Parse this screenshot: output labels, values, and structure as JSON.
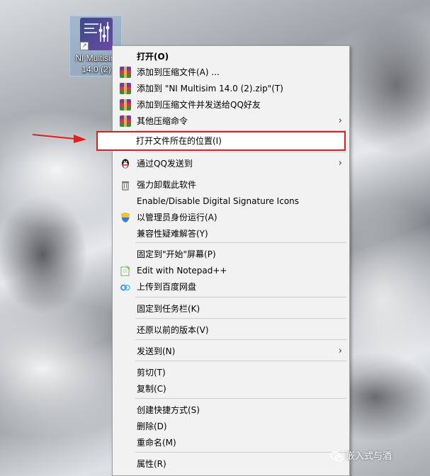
{
  "desktop_icon": {
    "label": "NI Multisim 14.0 (2)",
    "label_lines": [
      "NI Multisim",
      "14.0 (2)"
    ]
  },
  "context_menu": {
    "items": [
      {
        "label": "打开(O)",
        "bold": true,
        "icon": "none"
      },
      {
        "label": "添加到压缩文件(A) ...",
        "icon": "winrar-icon"
      },
      {
        "label": "添加到 \"NI Multisim 14.0 (2).zip\"(T)",
        "icon": "winrar-icon"
      },
      {
        "label": "添加到压缩文件并发送给QQ好友",
        "icon": "winrar-icon"
      },
      {
        "label": "其他压缩命令",
        "icon": "winrar-icon",
        "submenu": true
      },
      {
        "label": "打开文件所在的位置(I)",
        "icon": "none",
        "highlighted": true
      },
      {
        "label": "通过QQ发送到",
        "icon": "qq-penguin-icon",
        "submenu": true
      },
      {
        "label": "强力卸载此软件",
        "icon": "trash-icon"
      },
      {
        "label": "Enable/Disable Digital Signature Icons",
        "icon": "none"
      },
      {
        "label": "以管理员身份运行(A)",
        "icon": "uac-shield-icon"
      },
      {
        "label": "兼容性疑难解答(Y)",
        "icon": "none"
      },
      {
        "label": "固定到\"开始\"屏幕(P)",
        "icon": "none"
      },
      {
        "label": "Edit with Notepad++",
        "icon": "notepad-plus-plus-icon"
      },
      {
        "label": "上传到百度网盘",
        "icon": "baidu-netdisk-icon"
      },
      {
        "label": "固定到任务栏(K)",
        "icon": "none"
      },
      {
        "label": "还原以前的版本(V)",
        "icon": "none"
      },
      {
        "label": "发送到(N)",
        "icon": "none",
        "submenu": true
      },
      {
        "label": "剪切(T)",
        "icon": "none"
      },
      {
        "label": "复制(C)",
        "icon": "none"
      },
      {
        "label": "创建快捷方式(S)",
        "icon": "none"
      },
      {
        "label": "删除(D)",
        "icon": "none"
      },
      {
        "label": "重命名(M)",
        "icon": "none"
      },
      {
        "label": "属性(R)",
        "icon": "none"
      }
    ],
    "submenu_glyph": "›"
  },
  "annotation": {
    "highlight_color": "#e02020",
    "arrow_color": "#e02020"
  },
  "watermark": {
    "text": "嵌入式与酒"
  }
}
